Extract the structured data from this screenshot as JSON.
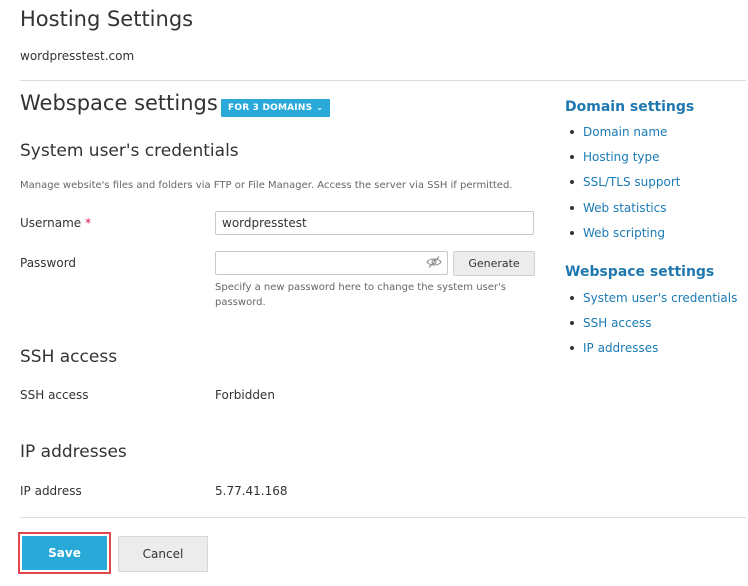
{
  "page": {
    "title": "Hosting Settings",
    "domain": "wordpresstest.com"
  },
  "webspace": {
    "title": "Webspace settings",
    "scope_badge": "FOR 3 DOMAINS",
    "scope_caret": "⌄"
  },
  "credentials": {
    "title": "System user's credentials",
    "description": "Manage website's files and folders via FTP or File Manager. Access the server via SSH if permitted.",
    "username_label": "Username",
    "required_mark": "*",
    "username_value": "wordpresstest",
    "password_label": "Password",
    "password_value": "",
    "generate_label": "Generate",
    "password_hint_line1": "Specify a new password here to change the system user's",
    "password_hint_line2": "password."
  },
  "ssh": {
    "title": "SSH access",
    "label": "SSH access",
    "value": "Forbidden"
  },
  "ip": {
    "title": "IP addresses",
    "label": "IP address",
    "value": "5.77.41.168"
  },
  "buttons": {
    "save": "Save",
    "cancel": "Cancel"
  },
  "sidebar": {
    "domain_heading": "Domain settings",
    "domain_items": [
      "Domain name",
      "Hosting type",
      "SSL/TLS support",
      "Web statistics",
      "Web scripting"
    ],
    "webspace_heading": "Webspace settings",
    "webspace_items": [
      "System user's credentials",
      "SSH access",
      "IP addresses"
    ]
  },
  "colors": {
    "accent": "#28a9d8",
    "link": "#1a7bb5",
    "highlight_border": "#e0484c",
    "required": "#d4145a"
  },
  "icons": {
    "password_toggle": "eye-slash-icon",
    "scope_dropdown": "chevron-down-icon"
  }
}
